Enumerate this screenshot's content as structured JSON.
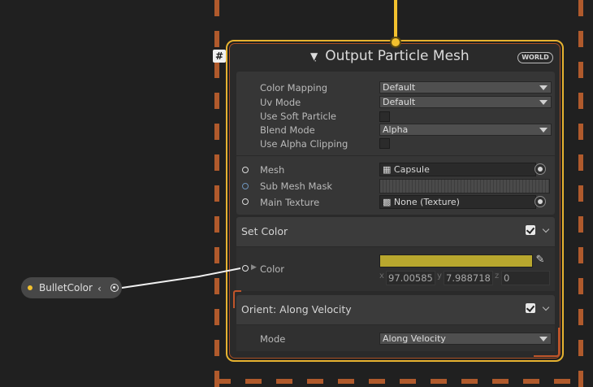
{
  "context": {
    "title": "Output Particle Mesh",
    "space_badge": "WORLD",
    "hash_badge": "#",
    "settings": [
      {
        "label": "Color Mapping",
        "value": "Default"
      },
      {
        "label": "Uv Mode",
        "value": "Default"
      },
      {
        "label": "Use Soft Particle",
        "checked": false
      },
      {
        "label": "Blend Mode",
        "value": "Alpha"
      },
      {
        "label": "Use Alpha Clipping",
        "checked": false
      }
    ],
    "inputs": [
      {
        "label": "Mesh",
        "value": "Capsule",
        "icon": "mesh-grid-icon"
      },
      {
        "label": "Sub Mesh Mask",
        "value": ""
      },
      {
        "label": "Main Texture",
        "value": "None (Texture)",
        "icon": "texture-icon"
      }
    ]
  },
  "blocks": {
    "set_color": {
      "title": "Set Color",
      "enabled": true,
      "property_label": "Color",
      "swatch_color": "#b8a72e",
      "vector": {
        "x_label": "x",
        "x": "97.00585",
        "y_label": "y",
        "y": "7.988718",
        "z_label": "z",
        "z": "0"
      }
    },
    "orient": {
      "title": "Orient: Along Velocity",
      "enabled": true,
      "mode_label": "Mode",
      "mode_value": "Along Velocity"
    }
  },
  "property_node": {
    "label": "BulletColor",
    "dot_color": "#f2c12e"
  },
  "colors": {
    "flow": "#f2c12e",
    "system_border": "#b05a2c",
    "context_border": "#e6b230"
  }
}
